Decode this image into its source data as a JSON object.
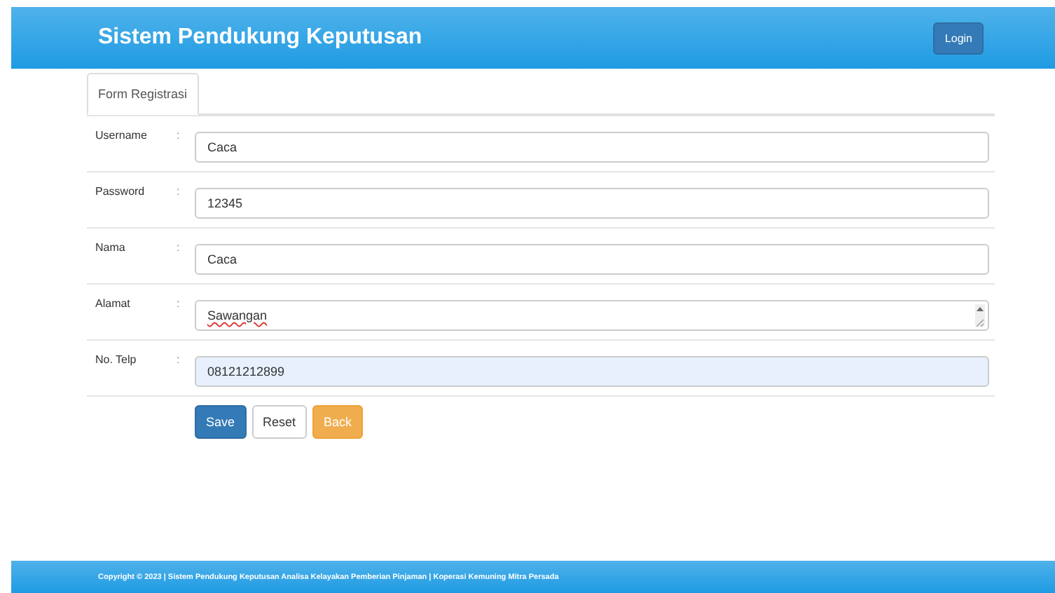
{
  "header": {
    "title": "Sistem Pendukung Keputusan",
    "login_button": "Login"
  },
  "tabs": [
    {
      "label": "Form Registrasi",
      "selected": true
    }
  ],
  "fields": [
    {
      "label": "Username",
      "separator": ":",
      "value": "Caca",
      "kind": "input",
      "highlighted": false
    },
    {
      "label": "Password",
      "separator": ":",
      "value": "12345",
      "kind": "input",
      "highlighted": false
    },
    {
      "label": "Nama",
      "separator": ":",
      "value": "Caca",
      "kind": "input",
      "highlighted": false
    },
    {
      "label": "Alamat",
      "separator": ":",
      "value": "Sawangan",
      "kind": "textarea",
      "highlighted": false
    },
    {
      "label": "No. Telp",
      "separator": ":",
      "value": "08121212899",
      "kind": "input",
      "highlighted": true
    }
  ],
  "buttons": [
    {
      "label": "Save",
      "kind": "primary"
    },
    {
      "label": "Reset",
      "kind": "default"
    },
    {
      "label": "Back",
      "kind": "warning"
    }
  ],
  "footer": {
    "text": "Copyright © 2023 | Sistem Pendukung Keputusan Analisa Kelayakan Pemberian Pinjaman | Koperasi Kemuning Mitra Persada"
  }
}
